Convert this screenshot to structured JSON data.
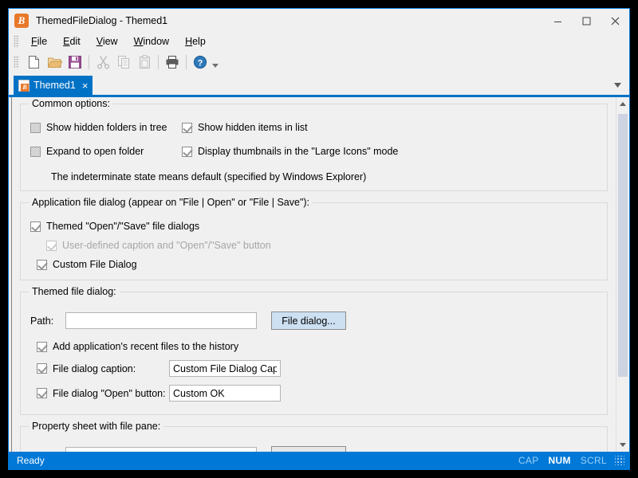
{
  "window": {
    "title": "ThemedFileDialog - Themed1",
    "app_icon": "B",
    "controls": {
      "minimize": "minimize-icon",
      "maximize": "maximize-icon",
      "close": "close-icon"
    }
  },
  "menubar": {
    "items": [
      {
        "label": "File",
        "mnemonic": "F"
      },
      {
        "label": "Edit",
        "mnemonic": "E"
      },
      {
        "label": "View",
        "mnemonic": "V"
      },
      {
        "label": "Window",
        "mnemonic": "W"
      },
      {
        "label": "Help",
        "mnemonic": "H"
      }
    ]
  },
  "toolbar": {
    "buttons": [
      {
        "name": "new-file-icon",
        "label": "New",
        "enabled": true
      },
      {
        "name": "open-folder-icon",
        "label": "Open",
        "enabled": true
      },
      {
        "name": "save-icon",
        "label": "Save",
        "enabled": true
      },
      {
        "name": "cut-icon",
        "label": "Cut",
        "enabled": false
      },
      {
        "name": "copy-icon",
        "label": "Copy",
        "enabled": false
      },
      {
        "name": "paste-icon",
        "label": "Paste",
        "enabled": false
      },
      {
        "name": "print-icon",
        "label": "Print",
        "enabled": true
      },
      {
        "name": "help-icon",
        "label": "Help",
        "enabled": true
      }
    ],
    "overflow_caret": "chevron-down-icon"
  },
  "tabs": {
    "items": [
      {
        "label": "Themed1",
        "active": true,
        "close": "×"
      }
    ],
    "list_button": "chevron-down-icon"
  },
  "groups": {
    "common_options": {
      "title": "Common options:",
      "checkboxes": [
        {
          "label": "Show hidden folders in tree",
          "state": "indeterminate",
          "enabled": true
        },
        {
          "label": "Show hidden items in list",
          "state": "checked",
          "enabled": true
        },
        {
          "label": "Expand to open folder",
          "state": "indeterminate",
          "enabled": true
        },
        {
          "label": "Display thumbnails in the \"Large Icons\" mode",
          "state": "checked",
          "enabled": true
        }
      ],
      "note": "The indeterminate state means default (specified by Windows Explorer)"
    },
    "application_file_dialog": {
      "title": "Application file dialog (appear on \"File | Open\" or \"File | Save\"):",
      "checkboxes": [
        {
          "label": "Themed \"Open\"/\"Save\" file dialogs",
          "state": "checked",
          "enabled": true
        },
        {
          "label": "User-defined caption and \"Open\"/\"Save\" button",
          "state": "checked",
          "enabled": false
        },
        {
          "label": "Custom File Dialog",
          "state": "checked",
          "enabled": true
        }
      ]
    },
    "themed_file_dialog": {
      "title": "Themed file dialog:",
      "path_label": "Path:",
      "path_value": "",
      "path_placeholder": "",
      "file_dialog_button": "File dialog...",
      "rows": [
        {
          "checkbox_label": "Add application's recent files to the history",
          "state": "checked",
          "has_input": false,
          "input_value": ""
        },
        {
          "checkbox_label": "File dialog caption:",
          "state": "checked",
          "has_input": true,
          "input_value": "Custom File Dialog Caption"
        },
        {
          "checkbox_label": "File dialog \"Open\" button:",
          "state": "checked",
          "has_input": true,
          "input_value": "Custom OK"
        }
      ]
    },
    "property_sheet": {
      "title": "Property sheet with file pane:",
      "input_value": "",
      "button_label": ""
    }
  },
  "scrollbar": {
    "up_arrow": "scroll-up-icon",
    "down_arrow": "scroll-down-icon"
  },
  "statusbar": {
    "message": "Ready",
    "indicators": [
      {
        "label": "CAP",
        "active": false
      },
      {
        "label": "NUM",
        "active": true
      },
      {
        "label": "SCRL",
        "active": false
      }
    ],
    "grip": "resize-grip-icon"
  },
  "colors": {
    "accent": "#0078d7",
    "tab_active": "#0072c6",
    "app_icon": "#e8792a",
    "save_icon": "#9b4f96",
    "folder_icon": "#e8b97d",
    "help_icon": "#2e78b8",
    "primary_button": "#cde0f2"
  }
}
